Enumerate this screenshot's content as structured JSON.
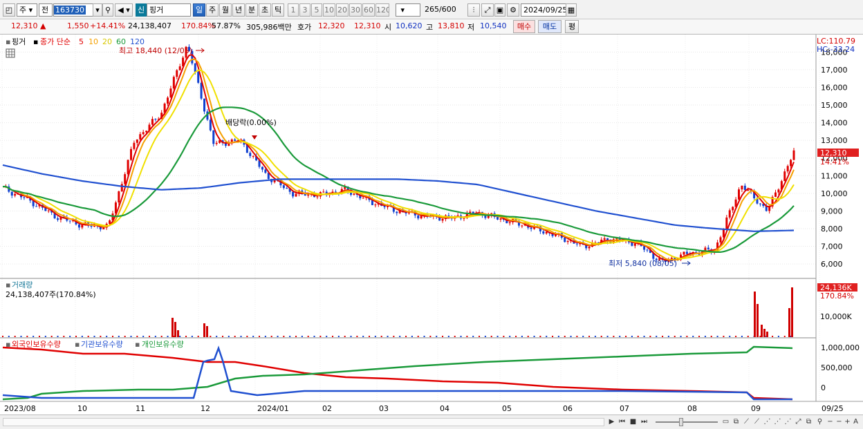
{
  "toolbar": {
    "market_select": "주",
    "mode_select": "전",
    "code": "163730",
    "name_badge": "신",
    "stock_name": "핑거",
    "periods": [
      "일",
      "주",
      "월",
      "년",
      "분",
      "초",
      "틱"
    ],
    "active_period": "일",
    "intervals": [
      "1",
      "3",
      "5",
      "10",
      "20",
      "30",
      "60",
      "120"
    ],
    "bar_count": "265",
    "bar_total": "/600",
    "date": "2024/09/25"
  },
  "quote": {
    "price": "12,310",
    "arrow": "▲",
    "change": "1,550",
    "change_pct": "+14.41%",
    "volume": "24,138,407",
    "vol_ratio": "170.84%",
    "turnover": "57.87%",
    "amount": "305,986백만",
    "ask_label": "호가",
    "ask": "12,320",
    "bid": "12,310",
    "open_label": "시",
    "open": "10,620",
    "high_label": "고",
    "high": "13,810",
    "low_label": "저",
    "low": "10,540",
    "buy_button": "매수",
    "sell_button": "매도",
    "eval_button": "평"
  },
  "price_panel": {
    "title": "핑거",
    "legend_label": "종가 단순",
    "ma_periods": [
      "5",
      "10",
      "20",
      "60",
      "120"
    ],
    "ma_colors": [
      "#e00000",
      "#f5a000",
      "#f0e000",
      "#1a9a3a",
      "#2050d0"
    ],
    "lc_label": "LC:110.79",
    "hc_label": "HC:-33.24",
    "high_annotation": "최고 18,440 (12/05)",
    "low_annotation": "최저 5,840 (08/05)",
    "dividend_annotation": "배당락(0.00%)",
    "price_tag": "12,310",
    "pct_tag": "14.41%"
  },
  "volume_panel": {
    "title": "거래량",
    "summary": "24,138,407주(170.84%)",
    "vol_tag": "24,136K",
    "vol_pct": "170.84%",
    "tick_label": "10,000K"
  },
  "holdings_panel": {
    "series": [
      {
        "name": "외국인보유수량",
        "color": "#e00000"
      },
      {
        "name": "기관보유수량",
        "color": "#2050d0"
      },
      {
        "name": "개인보유수량",
        "color": "#1a9a3a"
      }
    ]
  },
  "chart_data": [
    {
      "type": "line",
      "title": "핑거",
      "y_ticks": [
        6000,
        7000,
        8000,
        9000,
        10000,
        11000,
        12000,
        13000,
        14000,
        15000,
        16000,
        17000,
        18000
      ],
      "ylim": [
        5300,
        18600
      ],
      "tick_labels": [
        "6,000",
        "7,000",
        "8,000",
        "9,000",
        "10,000",
        "11,000",
        "12,000",
        "13,000",
        "14,000",
        "15,000",
        "16,000",
        "17,000",
        "18,000"
      ],
      "x_labels": [
        "2023/08",
        "10",
        "11",
        "12",
        "2024/01",
        "02",
        "03",
        "04",
        "05",
        "06",
        "07",
        "08",
        "09",
        "09/25"
      ],
      "series": [
        {
          "name": "종가",
          "values": [
            10300,
            9600,
            8700,
            8200,
            8100,
            13000,
            14500,
            18440,
            12800,
            13000,
            11000,
            10000,
            9900,
            10200,
            9500,
            9000,
            8700,
            8600,
            8900,
            8500,
            8100,
            7600,
            7000,
            7400,
            7200,
            6100,
            6600,
            6800,
            10500,
            9000,
            12310
          ]
        },
        {
          "name": "120",
          "values": [
            11600,
            11100,
            10700,
            10400,
            10200,
            10300,
            10600,
            10800,
            10800,
            10800,
            10800,
            10700,
            10500,
            10000,
            9500,
            9000,
            8600,
            8200,
            8000,
            7850,
            7900
          ]
        }
      ]
    },
    {
      "type": "bar",
      "title": "거래량",
      "y_ticks": [
        10000
      ],
      "tick_labels": [
        "10,000K"
      ],
      "values": [
        2000,
        24136000
      ]
    },
    {
      "type": "line",
      "title": "보유수량",
      "y_ticks": [
        0,
        500000,
        1000000
      ],
      "tick_labels": [
        "0",
        "500,000",
        "1,000,000"
      ]
    }
  ],
  "bottom_bar": {
    "icons": [
      "play-icon",
      "rewind-icon",
      "stop-icon",
      "forward-icon",
      "zoom-slider",
      "zoom-out-icon",
      "zoom-in-icon",
      "add-icon",
      "font-icon"
    ]
  }
}
